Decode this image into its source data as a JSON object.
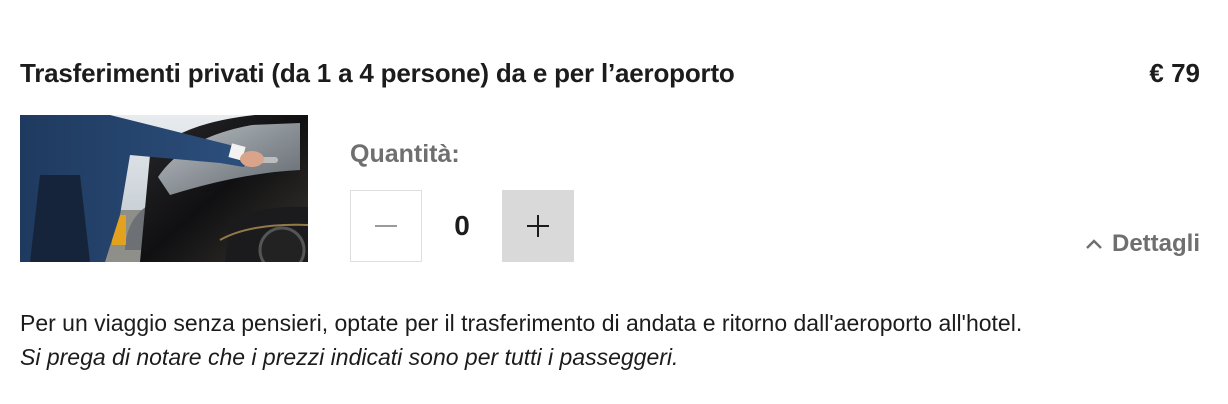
{
  "product": {
    "title": "Trasferimenti privati (da 1 a 4 persone) da e per l’aeroporto",
    "price": "€ 79",
    "image_alt": "chauffeur opening car door"
  },
  "quantity": {
    "label": "Quantità:",
    "value": "0",
    "decrement_icon": "minus-icon",
    "increment_icon": "plus-icon"
  },
  "details_toggle": {
    "label": "Dettagli",
    "icon": "chevron-up-icon"
  },
  "description": {
    "text": "Per un viaggio senza pensieri, optate per il trasferimento di andata e ritorno dall'aeroporto all'hotel.",
    "note": "Si prega di notare che i prezzi indicati sono per tutti i passeggeri."
  },
  "colors": {
    "stepper_plus_bg": "#d9d9d9",
    "muted_text": "#6f6f6f",
    "primary_text": "#1c1c1c"
  }
}
